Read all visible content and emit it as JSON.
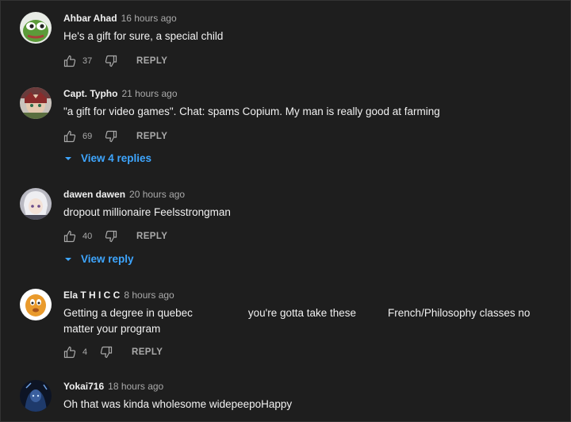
{
  "comments": [
    {
      "author": "Ahbar Ahad",
      "time": "16 hours ago",
      "text": "He's a gift for sure, a special child",
      "likes": "37",
      "reply_label": "REPLY",
      "avatar": "pepe-frog-avatar"
    },
    {
      "author": "Capt. Typho",
      "time": "21 hours ago",
      "text": "\"a gift for video games\". Chat: spams Copium. My man is really good at farming",
      "likes": "69",
      "reply_label": "REPLY",
      "view_replies": "View 4 replies",
      "avatar": "anime-character-avatar"
    },
    {
      "author": "dawen dawen",
      "time": "20 hours ago",
      "text": "dropout millionaire Feelsstrongman",
      "likes": "40",
      "reply_label": "REPLY",
      "view_replies": "View reply",
      "avatar": "white-hair-character-avatar"
    },
    {
      "author": "Ela T H I C C",
      "time": "8 hours ago",
      "text_parts": [
        "Getting a degree in quebec",
        "you're gotta take these",
        "French/Philosophy classes no"
      ],
      "text_line2": "matter your program",
      "likes": "4",
      "reply_label": "REPLY",
      "avatar": "orange-cartoon-avatar"
    },
    {
      "author": "Yokai716",
      "time": "18 hours ago",
      "text": "Oh that was kinda wholesome widepeepoHappy",
      "avatar": "dark-blue-character-avatar"
    }
  ],
  "colors": {
    "background": "#1f1f1f",
    "link": "#3ea6ff",
    "secondary_text": "#aaaaaa"
  }
}
